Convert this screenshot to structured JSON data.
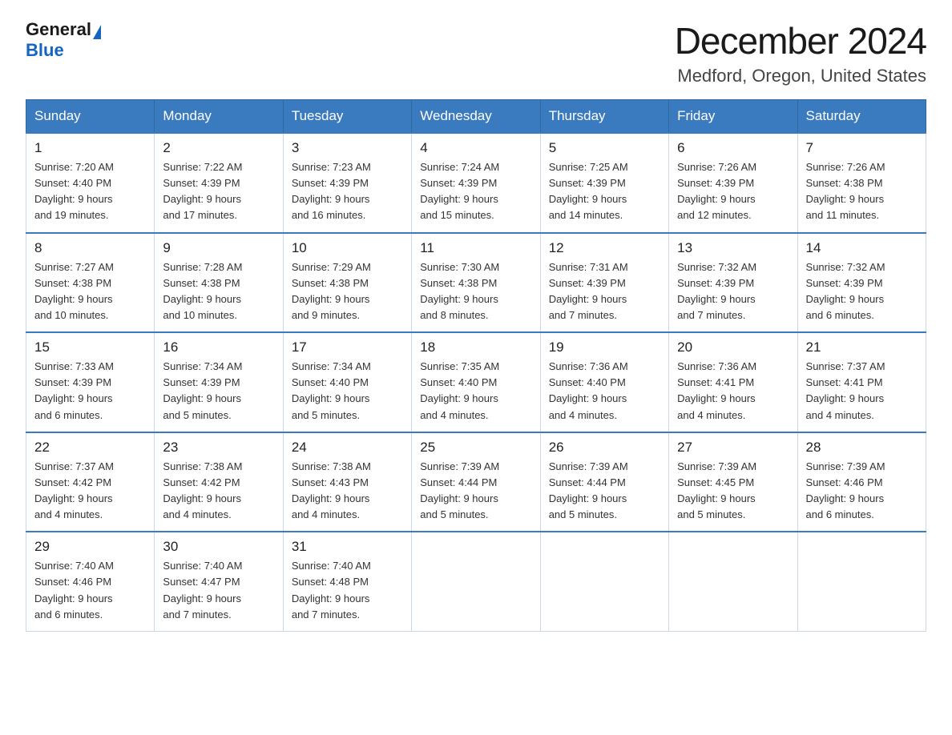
{
  "logo": {
    "general": "General",
    "blue": "Blue"
  },
  "header": {
    "title": "December 2024",
    "subtitle": "Medford, Oregon, United States"
  },
  "weekdays": [
    "Sunday",
    "Monday",
    "Tuesday",
    "Wednesday",
    "Thursday",
    "Friday",
    "Saturday"
  ],
  "weeks": [
    [
      {
        "day": "1",
        "sunrise": "7:20 AM",
        "sunset": "4:40 PM",
        "daylight": "9 hours and 19 minutes."
      },
      {
        "day": "2",
        "sunrise": "7:22 AM",
        "sunset": "4:39 PM",
        "daylight": "9 hours and 17 minutes."
      },
      {
        "day": "3",
        "sunrise": "7:23 AM",
        "sunset": "4:39 PM",
        "daylight": "9 hours and 16 minutes."
      },
      {
        "day": "4",
        "sunrise": "7:24 AM",
        "sunset": "4:39 PM",
        "daylight": "9 hours and 15 minutes."
      },
      {
        "day": "5",
        "sunrise": "7:25 AM",
        "sunset": "4:39 PM",
        "daylight": "9 hours and 14 minutes."
      },
      {
        "day": "6",
        "sunrise": "7:26 AM",
        "sunset": "4:39 PM",
        "daylight": "9 hours and 12 minutes."
      },
      {
        "day": "7",
        "sunrise": "7:26 AM",
        "sunset": "4:38 PM",
        "daylight": "9 hours and 11 minutes."
      }
    ],
    [
      {
        "day": "8",
        "sunrise": "7:27 AM",
        "sunset": "4:38 PM",
        "daylight": "9 hours and 10 minutes."
      },
      {
        "day": "9",
        "sunrise": "7:28 AM",
        "sunset": "4:38 PM",
        "daylight": "9 hours and 10 minutes."
      },
      {
        "day": "10",
        "sunrise": "7:29 AM",
        "sunset": "4:38 PM",
        "daylight": "9 hours and 9 minutes."
      },
      {
        "day": "11",
        "sunrise": "7:30 AM",
        "sunset": "4:38 PM",
        "daylight": "9 hours and 8 minutes."
      },
      {
        "day": "12",
        "sunrise": "7:31 AM",
        "sunset": "4:39 PM",
        "daylight": "9 hours and 7 minutes."
      },
      {
        "day": "13",
        "sunrise": "7:32 AM",
        "sunset": "4:39 PM",
        "daylight": "9 hours and 7 minutes."
      },
      {
        "day": "14",
        "sunrise": "7:32 AM",
        "sunset": "4:39 PM",
        "daylight": "9 hours and 6 minutes."
      }
    ],
    [
      {
        "day": "15",
        "sunrise": "7:33 AM",
        "sunset": "4:39 PM",
        "daylight": "9 hours and 6 minutes."
      },
      {
        "day": "16",
        "sunrise": "7:34 AM",
        "sunset": "4:39 PM",
        "daylight": "9 hours and 5 minutes."
      },
      {
        "day": "17",
        "sunrise": "7:34 AM",
        "sunset": "4:40 PM",
        "daylight": "9 hours and 5 minutes."
      },
      {
        "day": "18",
        "sunrise": "7:35 AM",
        "sunset": "4:40 PM",
        "daylight": "9 hours and 4 minutes."
      },
      {
        "day": "19",
        "sunrise": "7:36 AM",
        "sunset": "4:40 PM",
        "daylight": "9 hours and 4 minutes."
      },
      {
        "day": "20",
        "sunrise": "7:36 AM",
        "sunset": "4:41 PM",
        "daylight": "9 hours and 4 minutes."
      },
      {
        "day": "21",
        "sunrise": "7:37 AM",
        "sunset": "4:41 PM",
        "daylight": "9 hours and 4 minutes."
      }
    ],
    [
      {
        "day": "22",
        "sunrise": "7:37 AM",
        "sunset": "4:42 PM",
        "daylight": "9 hours and 4 minutes."
      },
      {
        "day": "23",
        "sunrise": "7:38 AM",
        "sunset": "4:42 PM",
        "daylight": "9 hours and 4 minutes."
      },
      {
        "day": "24",
        "sunrise": "7:38 AM",
        "sunset": "4:43 PM",
        "daylight": "9 hours and 4 minutes."
      },
      {
        "day": "25",
        "sunrise": "7:39 AM",
        "sunset": "4:44 PM",
        "daylight": "9 hours and 5 minutes."
      },
      {
        "day": "26",
        "sunrise": "7:39 AM",
        "sunset": "4:44 PM",
        "daylight": "9 hours and 5 minutes."
      },
      {
        "day": "27",
        "sunrise": "7:39 AM",
        "sunset": "4:45 PM",
        "daylight": "9 hours and 5 minutes."
      },
      {
        "day": "28",
        "sunrise": "7:39 AM",
        "sunset": "4:46 PM",
        "daylight": "9 hours and 6 minutes."
      }
    ],
    [
      {
        "day": "29",
        "sunrise": "7:40 AM",
        "sunset": "4:46 PM",
        "daylight": "9 hours and 6 minutes."
      },
      {
        "day": "30",
        "sunrise": "7:40 AM",
        "sunset": "4:47 PM",
        "daylight": "9 hours and 7 minutes."
      },
      {
        "day": "31",
        "sunrise": "7:40 AM",
        "sunset": "4:48 PM",
        "daylight": "9 hours and 7 minutes."
      },
      null,
      null,
      null,
      null
    ]
  ],
  "labels": {
    "sunrise": "Sunrise:",
    "sunset": "Sunset:",
    "daylight": "Daylight: 9 hours"
  }
}
